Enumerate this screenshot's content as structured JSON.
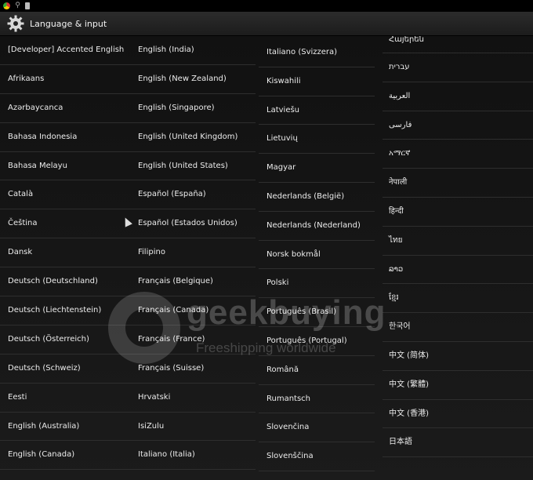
{
  "statusbar": {
    "icons": [
      "chrome-icon",
      "usb-icon",
      "sdcard-icon"
    ]
  },
  "actionbar": {
    "title": "Language & input",
    "icon": "settings-gear-icon"
  },
  "columns": [
    [
      "[Developer] Accented English",
      "Afrikaans",
      "Azərbaycanca",
      "Bahasa Indonesia",
      "Bahasa Melayu",
      "Català",
      "Čeština",
      "Dansk",
      "Deutsch (Deutschland)",
      "Deutsch (Liechtenstein)",
      "Deutsch (Österreich)",
      "Deutsch (Schweiz)",
      "Eesti",
      "English (Australia)",
      "English (Canada)"
    ],
    [
      "English (India)",
      "English (New Zealand)",
      "English (Singapore)",
      "English (United Kingdom)",
      "English (United States)",
      "Español (España)",
      "Español (Estados Unidos)",
      "Filipino",
      "Français (Belgique)",
      "Français (Canada)",
      "Français (France)",
      "Français (Suisse)",
      "Hrvatski",
      "IsiZulu",
      "Italiano (Italia)"
    ],
    [
      "Italiano (Svizzera)",
      "Kiswahili",
      "Latviešu",
      "Lietuvių",
      "Magyar",
      "Nederlands (België)",
      "Nederlands (Nederland)",
      "Norsk bokmål",
      "Polski",
      "Português (Brasil)",
      "Português (Portugal)",
      "Română",
      "Rumantsch",
      "Slovenčina",
      "Slovenščina"
    ],
    [
      "Հայերեն",
      "עברית",
      "العربية",
      "فارسی",
      "አማርኛ",
      "नेपाली",
      "हिन्दी",
      "ไทย",
      "ລາວ",
      "ខ្មែរ",
      "한국어",
      "中文 (简体)",
      "中文 (繁體)",
      "中文 (香港)",
      "日本語"
    ]
  ],
  "watermark": {
    "brand": "geekbuying",
    "tagline": "Freeshipping worldwide"
  }
}
